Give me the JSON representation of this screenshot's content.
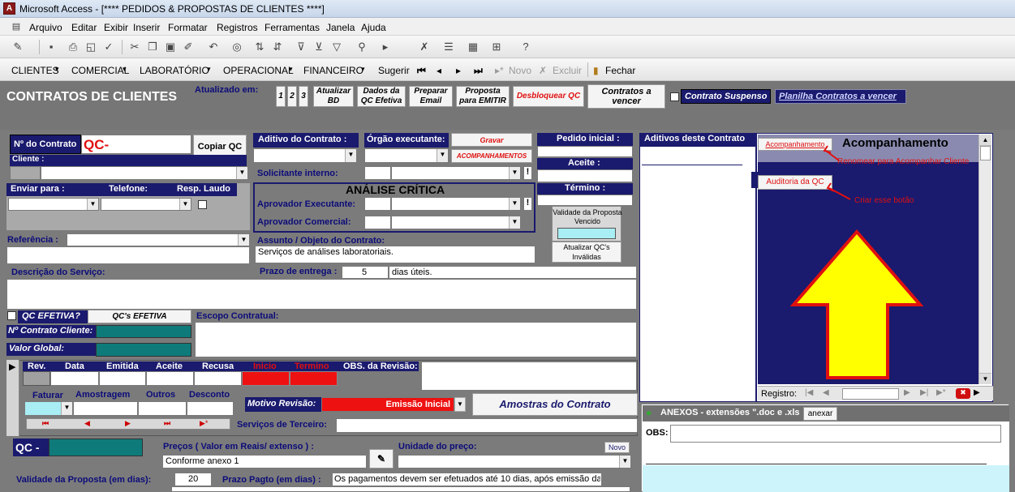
{
  "window": {
    "title": "Microsoft Access - [**** PEDIDOS & PROPOSTAS DE CLIENTES ****]"
  },
  "menu": [
    "Arquivo",
    "Editar",
    "Exibir",
    "Inserir",
    "Formatar",
    "Registros",
    "Ferramentas",
    "Janela",
    "Ajuda"
  ],
  "custom_menu": {
    "clientes": "CLIENTES",
    "comercial": "COMERCIAL",
    "laboratorio": "LABORATÓRIO",
    "operacional": "OPERACIONAL",
    "financeiro": "FINANCEIRO",
    "sugerir": "Sugerir",
    "novo": "Novo",
    "excluir": "Excluir",
    "fechar": "Fechar"
  },
  "header": {
    "title": "CONTRATOS DE CLIENTES",
    "atualizado_em": "Atualizado em:",
    "b1": "1",
    "b2": "2",
    "b3": "3",
    "atualizar_bd": "Atualizar BD",
    "dados_qc": "Dados da QC Efetiva",
    "preparar_email": "Preparar Email",
    "proposta": "Proposta para EMITIR",
    "desbloquear": "Desbloquear QC",
    "contratos_vencer": "Contratos a vencer",
    "contrato_suspenso": "Contrato Suspenso",
    "planilha": "Planilha Contratos a vencer"
  },
  "form": {
    "no_contrato": "Nº do Contrato",
    "qc_prefix": "QC-",
    "copiar_qc": "Copiar QC",
    "cliente": "Cliente :",
    "enviar_para": "Enviar para :",
    "telefone": "Telefone:",
    "resp_laudo": "Resp. Laudo",
    "referencia": "Referência :",
    "aditivo": "Aditivo do Contrato :",
    "orgao": "Órgão executante:",
    "gravar": "Gravar",
    "acompanhamentos": "ACOMPANHAMENTOS",
    "solicitante": "Solicitante interno:",
    "analise": "ANÁLISE CRÍTICA",
    "aprov_exec": "Aprovador Executante:",
    "aprov_com": "Aprovador Comercial:",
    "assunto": "Assunto / Objeto do Contrato:",
    "assunto_val": "Serviços de análises laboratoriais.",
    "pedido_inicial": "Pedido inicial :",
    "aceite": "Aceite :",
    "termino": "Término :",
    "validade_vencido": "Validade da Proposta Vencido",
    "atualizar_qcs": "Atualizar QC's Inválidas",
    "descricao": "Descrição do Serviço:",
    "prazo_entrega": "Prazo de entrega :",
    "prazo_val": "5",
    "dias_uteis": "dias úteis.",
    "qc_efetiva": "QC EFETIVA?",
    "qcs_efetiva": "QC's EFETIVA",
    "escopo": "Escopo Contratual:",
    "no_contrato_cliente": "Nº Contrato Cliente:",
    "valor_global": "Valor Global:"
  },
  "revisions": {
    "cols": [
      "Rev.",
      "Data",
      "Emitida",
      "Aceite",
      "Recusa",
      "Inicio",
      "Termino"
    ],
    "obs": "OBS. da Revisão:",
    "faturar": "Faturar",
    "amostragem": "Amostragem",
    "outros": "Outros",
    "desconto": "Desconto",
    "motivo": "Motivo Revisão:",
    "motivo_val": "Emissão Inicial",
    "amostras": "Amostras do Contrato",
    "servicos_terceiro": "Serviços de Terceiro:"
  },
  "bottom": {
    "qc": "QC -",
    "precos": "Preços ( Valor em Reais/ extenso ) :",
    "precos_val": "Conforme anexo 1",
    "unidade": "Unidade do preço:",
    "novo": "Novo",
    "validade": "Validade da Proposta (em dias):",
    "validade_val": "20",
    "prazo_pagto": "Prazo Pagto (em dias) :",
    "prazo_pagto_val": "Os pagamentos devem ser efetuados até 10 dias, após emissão da"
  },
  "right": {
    "aditivos": "Aditivos deste Contrato",
    "acomp_btn": "Acompanhamento",
    "acomp_title": "Acompanhamento",
    "renomear": "Renomear para Acompanhar Cliente",
    "auditoria": "Auditoria da QC",
    "criar": "Criar esse botão",
    "registro": "Registro:",
    "anexos": "ANEXOS - extensões \".doc e .xls",
    "anexar": "anexar",
    "obs": "OBS:"
  },
  "colors": {
    "navy": "#1a1a6e",
    "teal": "#0e7a7a",
    "red": "#ee1111",
    "arrow": "#ffff00"
  }
}
